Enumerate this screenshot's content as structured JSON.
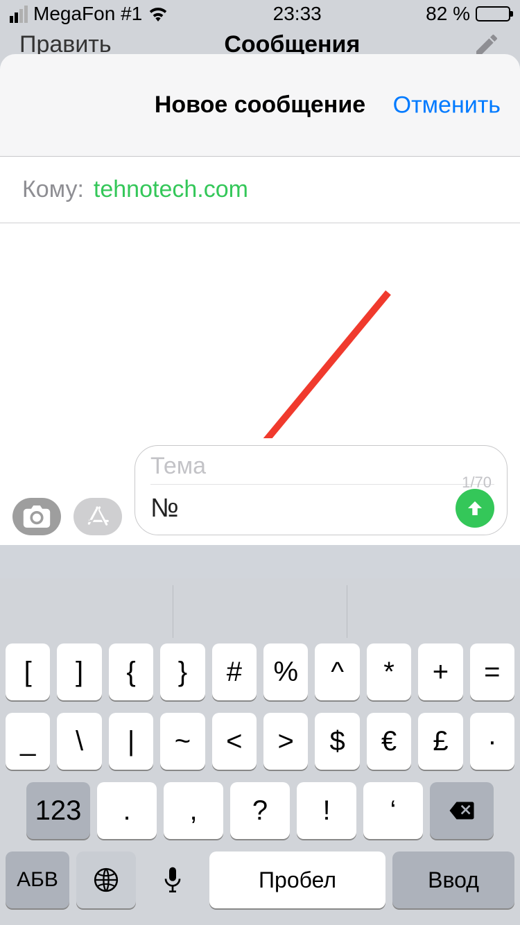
{
  "status": {
    "carrier": "MegaFon #1",
    "time": "23:33",
    "battery_text": "82 %"
  },
  "messages_header": {
    "edit": "Править",
    "title": "Сообщения"
  },
  "modal": {
    "title": "Новое сообщение",
    "cancel": "Отменить"
  },
  "to": {
    "label": "Кому:",
    "recipient": "tehnotech.com"
  },
  "composer": {
    "subject_placeholder": "Тема",
    "counter": "1/70",
    "message_value": "№"
  },
  "keyboard": {
    "row1": [
      "[",
      "]",
      "{",
      "}",
      "#",
      "%",
      "^",
      "*",
      "+",
      "="
    ],
    "row2": [
      "_",
      "\\",
      "|",
      "~",
      "<",
      ">",
      "$",
      "€",
      "£",
      "·"
    ],
    "row3_mod": "123",
    "row3": [
      ".",
      ",",
      "?",
      "!",
      "‘"
    ],
    "row4": {
      "abv": "АБВ",
      "space": "Пробел",
      "enter": "Ввод"
    }
  }
}
